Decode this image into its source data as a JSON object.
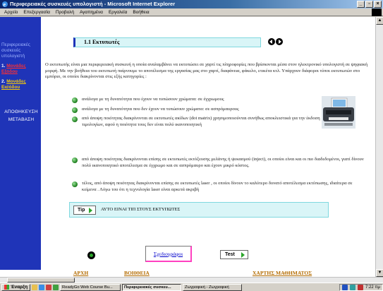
{
  "window": {
    "title": "Περιφερειακές συσκευές υπολογιστή - Microsoft Internet Explorer",
    "minimize": "_",
    "maximize": "▫",
    "close": "×"
  },
  "menu": [
    "Αρχείο",
    "Επεξεργασία",
    "Προβολή",
    "Αγαπημένα",
    "Εργαλεία",
    "Βοήθεια"
  ],
  "sidebar": {
    "title": "Περιφερειακές συσκευές υπολογιστή",
    "items": [
      {
        "num": "1.",
        "label": "Μονάδες Εξόδου"
      },
      {
        "num": "2.",
        "label": "Μονάδες Εισόδου"
      }
    ],
    "save_label": "ΑΠΟΘΗΚΕΥΣΗ",
    "goto_label": "ΜΕΤΑΒΑΣΗ"
  },
  "section": {
    "title": "1.1 Εκτυπωτές"
  },
  "intro": "Ο εκτυπωτής είναι μια περιφερειακή συσκευή η οποία αναλαμβάνει να εκτυπώσει σε χαρτί τις πληροφορίες που βρίσκονται μέσα στον ηλεκτρονικό υπολογιστή σε ψηφιακή μορφή. Με την βοήθεια του εκτυπωτή παίρνουμε το αποτέλεσμα της εργασίας μας στο χαρτί, διαφάνεια, φάκελο, ετικέτα κτλ. Υπάρχουν διάφοροι τύποι εκτυπωτών στο εμπόριο, οι οποίοι διακρίνονται στις εξής κατηγορίες :",
  "bullets": [
    "ανάλογα με τη δυνατότητα που έχουν να τυπώσουν χρώματα: σε έγχρωμους",
    "ανάλογα με τη δυνατότητα που δεν έχουν να τυπώσουν χρώματα: σε ασπρόμαυρους",
    "από άποψη ποιότητας διακρίνονται σε εκτυπωτές ακίδων (dot matrix) χρησιμοποιούνται συνήθως αποκλειστικά για την έκδοση τιμολογίων, αφού η ποιότητα τους δεν είναι πολύ ικανοποιητική",
    "από άποψη ποιότητας διακρίνονται επίσης σε εκτυπωτές εκτόξευσης μελάνης ή ψεκασμού (inject), οι οποίοι είναι και οι πιο διαδεδομένοι, γιατί δίνουν πολύ ικανοποιητικό αποτέλεσμα σε έγχρωμο και σε ασπρόμαυρο και έχουν μικρό κόστος.",
    "τέλος, από άποψη ποιότητας διακρίνονται επίσης σε εκτυπωτές laser , οι οποίοι δίνουν το καλύτερο δυνατό αποτέλεσμα εκτύπωσης, ιδιαίτερα σε κείμενα . Λόγω του ότι η τεχνολογία laser είναι αρκετά ακριβή"
  ],
  "tip": {
    "button": "Tip",
    "text": "ΑΥΤΟ ΕΙΝΑΙ ΤΙΠ ΣΤΟΥΣ ΕΚΤΥΠΩΤΕΣ"
  },
  "glossary_label": "Σχεδιογράφοι",
  "test_label": "Test",
  "bottom_nav": {
    "home": "ΑΡΧΗ",
    "help": "ΒΟΗΘΕΙΑ",
    "map": "ΧΑΡΤΗΣ ΜΑΘΗΜΑΤΟΣ"
  },
  "taskbar": {
    "start": "Έναρξη",
    "tasks": [
      "ReadyGo Web Course Bu...",
      "Περιφερειακές συσκευ...",
      "Ζωγραφική - Ζωγραφική"
    ],
    "clock": "7:22 πμ"
  },
  "colors": {
    "sidebar": "#1f34b8",
    "header_bg": "#d9f5f7",
    "link_orange": "#b36b00",
    "bullet_green": "#2a8a2a"
  }
}
